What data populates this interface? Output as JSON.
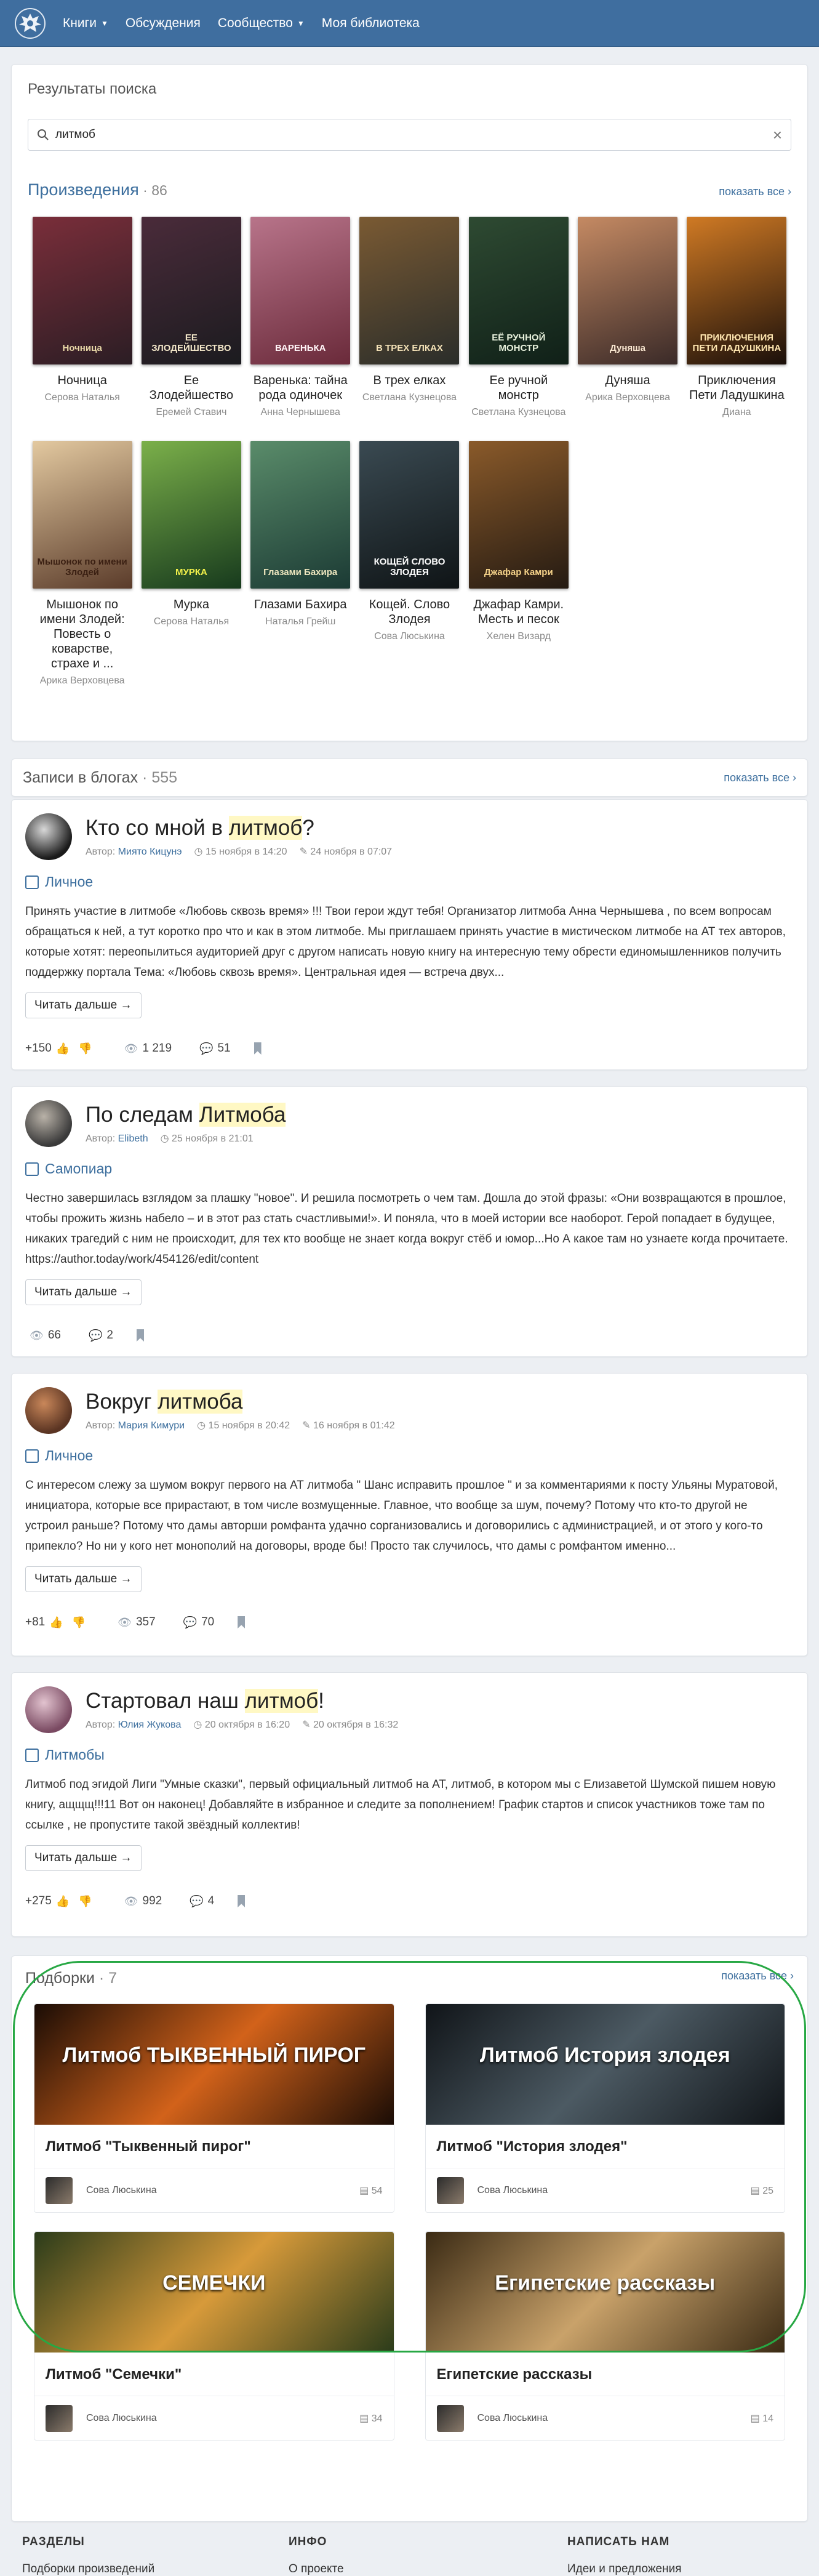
{
  "nav": {
    "items": [
      "Книги",
      "Обсуждения",
      "Сообщество",
      "Моя библиотека"
    ],
    "has_caret": [
      true,
      false,
      true,
      false
    ]
  },
  "search": {
    "title": "Результаты поиска",
    "query": "литмоб"
  },
  "works": {
    "title": "Произведения",
    "count": "86",
    "more": "показать все",
    "books": [
      {
        "title": "Ночница",
        "author": "Серова Наталья",
        "cover_text": "Ночница",
        "colors": [
          "#2b1d24",
          "#7a2e3a"
        ],
        "text_color": "#e9d9a8"
      },
      {
        "title": "Ее Злодейшество",
        "author": "Еремей Ставич",
        "cover_text": "ЕЕ ЗЛОДЕЙШЕСТВО",
        "colors": [
          "#1b1b1f",
          "#4a2b3a"
        ],
        "text_color": "#f2e6c8"
      },
      {
        "title": "Варенька: тайна рода одиночек",
        "author": "Анна Чернышева",
        "cover_text": "ВАРЕНЬКА",
        "colors": [
          "#6a2a3a",
          "#b8748a"
        ],
        "text_color": "#fff3f6"
      },
      {
        "title": "В трех елках",
        "author": "Светлана Кузнецова",
        "cover_text": "В ТРЕХ ЕЛКАХ",
        "colors": [
          "#2a2d2a",
          "#7a5a33"
        ],
        "text_color": "#f5e3b8"
      },
      {
        "title": "Ее ручной монстр",
        "author": "Светлана Кузнецова",
        "cover_text": "ЕЁ РУЧНОЙ МОНСТР",
        "colors": [
          "#102018",
          "#2e4a32"
        ],
        "text_color": "#e9f2dd"
      },
      {
        "title": "Дуняша",
        "author": "Арика Верховцева",
        "cover_text": "Дуняша",
        "colors": [
          "#3a2a28",
          "#c58a63"
        ],
        "text_color": "#fbe9d2"
      },
      {
        "title": "Приключения Пети Ладушкина",
        "author": "Диана",
        "cover_text": "ПРИКЛЮЧЕНИЯ ПЕТИ ЛАДУШКИНА",
        "colors": [
          "#1a0f0a",
          "#d07a24"
        ],
        "text_color": "#ffe6b0"
      },
      {
        "title": "Мышонок по имени Злодей: Повесть о коварстве, страхе и ...",
        "author": "Арика Верховцева",
        "cover_text": "Мышонок по имени Злодей",
        "colors": [
          "#5a3b2a",
          "#e3c9a0"
        ],
        "text_color": "#3a1f12"
      },
      {
        "title": "Мурка",
        "author": "Серова Наталья",
        "cover_text": "МУРКА",
        "colors": [
          "#173a1d",
          "#7bb04a"
        ],
        "text_color": "#f2f04a"
      },
      {
        "title": "Глазами Бахира",
        "author": "Наталья Грейш",
        "cover_text": "Глазами Бахира",
        "colors": [
          "#1b3a34",
          "#5a8c6a"
        ],
        "text_color": "#f0e8c0"
      },
      {
        "title": "Кощей. Слово Злодея",
        "author": "Сова Люськина",
        "cover_text": "КОЩЕЙ СЛОВО ЗЛОДЕЯ",
        "colors": [
          "#0f1416",
          "#3a4a52"
        ],
        "text_color": "#ffffff"
      },
      {
        "title": "Джафар Камри. Месть и песок",
        "author": "Хелен Визард",
        "cover_text": "Джафар Камри",
        "colors": [
          "#241a12",
          "#8a5a2a"
        ],
        "text_color": "#f6d38a"
      }
    ]
  },
  "blogs": {
    "title": "Записи в блогах",
    "count": "555",
    "more": "показать все",
    "read_more": "Читать дальше →",
    "author_prefix": "Автор:",
    "posts": [
      {
        "title_pre": "Кто со мной в ",
        "title_hl": "литмоб",
        "title_post": "?",
        "author": "Миято Кицунэ",
        "created": "15 ноября в 14:20",
        "edited": "24 ноября в 07:07",
        "category": "Личное",
        "text": "Принять участие в литмобе «Любовь сквозь время» !!! Твои герои ждут тебя! Организатор литмоба Анна Чернышева , по всем вопросам обращаться к ней, а тут коротко про что и как в этом литмобе. Мы приглашаем принять участие в мистическом литмобе на АТ тех авторов, которые хотят: переопылиться аудиторией друг с другом написать новую книгу на интересную тему обрести единомышленников получить поддержку портала Тема: «Любовь сквозь время». Центральная идея — встреча двух...",
        "likes": "+150",
        "views": "1 219",
        "comments": "51",
        "avatar_colors": [
          "#1a1a1a",
          "#d8d8d8"
        ]
      },
      {
        "title_pre": "По следам ",
        "title_hl": "Литмоба",
        "title_post": "",
        "author": "Elibeth",
        "created": "25 ноября в 21:01",
        "edited": "",
        "category": "Самопиар",
        "text": "Честно завершилась взглядом за плашку \"новое\". И решила посмотреть о чем там. Дошла до этой фразы: «Они возвращаются в прошлое, чтобы прожить жизнь набело – и в этот раз стать счастливыми!». И поняла, что в моей истории все наоборот. Герой попадает в будущее, никаких трагедий с ним не происходит, для тех кто вообще не знает когда вокруг стёб и юмор...Но А какое там но узнаете когда прочитаете. https://author.today/work/454126/edit/content",
        "likes": "",
        "views": "66",
        "comments": "2",
        "avatar_colors": [
          "#3a3a3a",
          "#b9b2a8"
        ]
      },
      {
        "title_pre": "Вокруг ",
        "title_hl": "литмоба",
        "title_post": "",
        "author": "Мария Кимури",
        "created": "15 ноября в 20:42",
        "edited": "16 ноября в 01:42",
        "category": "Личное",
        "text": "С интересом слежу за шумом вокруг первого на АТ литмоба \" Шанс исправить прошлое \" и за комментариями к посту Ульяны Муратовой, инициатора, которые все прирастают, в том числе возмущенные. Главное, что вообще за шум, почему? Потому что кто-то другой не устроил раньше? Потому что дамы авторши ромфанта удачно сорганизовались и договорились с администрацией, и от этого у кого-то припекло? Но ни у кого нет монополий на договоры, вроде бы! Просто так случилось, что дамы с ромфантом именно...",
        "likes": "+81",
        "views": "357",
        "comments": "70",
        "avatar_colors": [
          "#5a3422",
          "#c9875a"
        ]
      },
      {
        "title_pre": "Стартовал наш ",
        "title_hl": "литмоб",
        "title_post": "!",
        "author": "Юлия Жукова",
        "created": "20 октября в 16:20",
        "edited": "20 октября в 16:32",
        "category": "Литмобы",
        "text": "Литмоб под эгидой Лиги \"Умные сказки\", первый официальный литмоб на АТ, литмоб, в котором мы с Елизаветой Шумской пишем новую книгу, ащщщ!!!11 Вот он наконец! Добавляйте в избранное и следите за пополнением! График стартов и список участников тоже там по ссылке , не пропустите такой звёздный коллектив!",
        "likes": "+275",
        "views": "992",
        "comments": "4",
        "avatar_colors": [
          "#7a4a62",
          "#e2c3cf"
        ]
      }
    ]
  },
  "selections": {
    "title": "Подборки",
    "count": "7",
    "more": "показать все",
    "items": [
      {
        "name": "Литмоб \"Тыквенный пирог\"",
        "banner": "Литмоб ТЫКВЕННЫЙ ПИРОГ",
        "author": "Сова Люськина",
        "count": "54",
        "colors": [
          "#1a0c05",
          "#d2621a"
        ]
      },
      {
        "name": "Литмоб \"История злодея\"",
        "banner": "Литмоб История злодея",
        "author": "Сова Люськина",
        "count": "25",
        "colors": [
          "#101418",
          "#4c5a63"
        ]
      },
      {
        "name": "Литмоб \"Семечки\"",
        "banner": "СЕМЕЧКИ",
        "author": "Сова Люськина",
        "count": "34",
        "colors": [
          "#2a3b1a",
          "#d79a3a"
        ]
      },
      {
        "name": "Египетские рассказы",
        "banner": "Египетские рассказы",
        "author": "Сова Люськина",
        "count": "14",
        "colors": [
          "#3a2a14",
          "#c9a26a"
        ]
      }
    ]
  },
  "footer": {
    "cols": [
      {
        "heading": "РАЗДЕЛЫ",
        "link": "Подборки произведений"
      },
      {
        "heading": "ИНФО",
        "link": "О проекте"
      },
      {
        "heading": "НАПИСАТЬ НАМ",
        "link": "Идеи и предложения"
      }
    ]
  },
  "colors": {
    "header": "#3f6e9f",
    "accent": "#3d6f9e",
    "highlight": "#fff8c4",
    "ring": "#27a844"
  }
}
